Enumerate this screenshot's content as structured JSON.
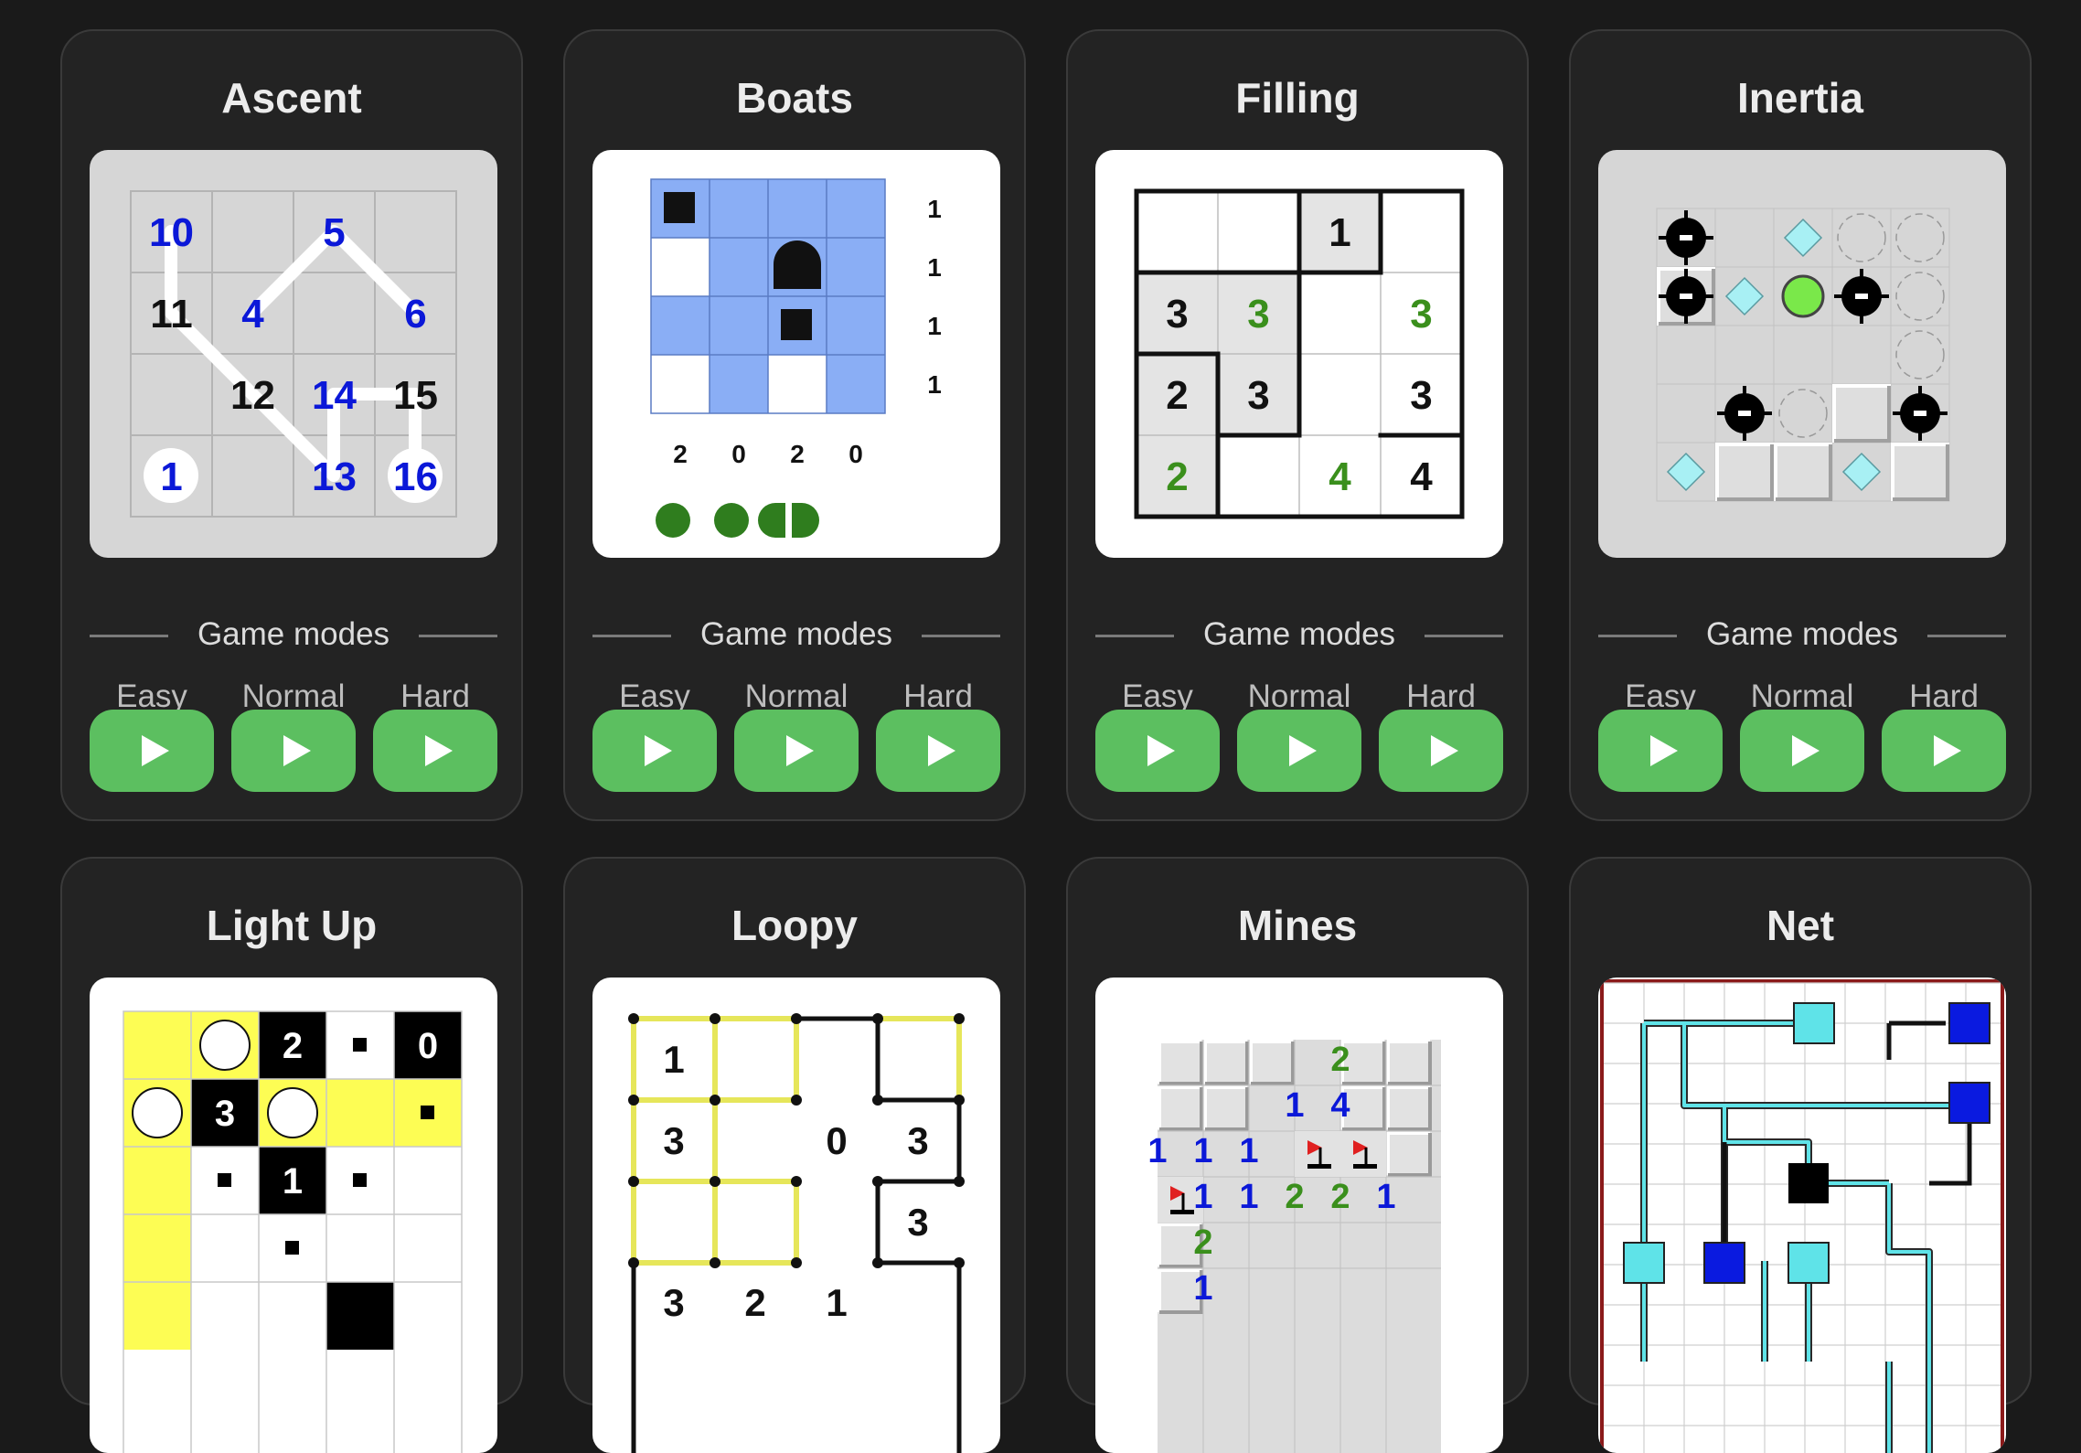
{
  "modes_label": "Game modes",
  "difficulties": [
    "Easy",
    "Normal",
    "Hard"
  ],
  "cards": [
    {
      "title": "Ascent"
    },
    {
      "title": "Boats"
    },
    {
      "title": "Filling"
    },
    {
      "title": "Inertia"
    },
    {
      "title": "Light Up"
    },
    {
      "title": "Loopy"
    },
    {
      "title": "Mines"
    },
    {
      "title": "Net"
    }
  ],
  "ascent": {
    "cells": [
      {
        "t": "10",
        "c": "blue"
      },
      {
        "t": "",
        "c": ""
      },
      {
        "t": "5",
        "c": "blue"
      },
      {
        "t": "",
        "c": ""
      },
      {
        "t": "11",
        "c": "black"
      },
      {
        "t": "4",
        "c": "blue"
      },
      {
        "t": "",
        "c": ""
      },
      {
        "t": "6",
        "c": "blue"
      },
      {
        "t": "",
        "c": ""
      },
      {
        "t": "12",
        "c": "black"
      },
      {
        "t": "14",
        "c": "blue"
      },
      {
        "t": "15",
        "c": "black"
      },
      {
        "t": "1",
        "c": "blue"
      },
      {
        "t": "",
        "c": ""
      },
      {
        "t": "13",
        "c": "blue"
      },
      {
        "t": "16",
        "c": "blue"
      }
    ]
  },
  "boats": {
    "row_clues": [
      "1",
      "1",
      "1",
      "1"
    ],
    "col_clues": [
      "2",
      "0",
      "2",
      "0"
    ]
  },
  "filling": {
    "cells": [
      {
        "t": "",
        "c": "black"
      },
      {
        "t": "",
        "c": "black"
      },
      {
        "t": "1",
        "c": "black"
      },
      {
        "t": "",
        "c": "black"
      },
      {
        "t": "3",
        "c": "black"
      },
      {
        "t": "3",
        "c": "green"
      },
      {
        "t": "",
        "c": "black"
      },
      {
        "t": "3",
        "c": "green"
      },
      {
        "t": "2",
        "c": "black"
      },
      {
        "t": "3",
        "c": "black"
      },
      {
        "t": "",
        "c": "black"
      },
      {
        "t": "3",
        "c": "black"
      },
      {
        "t": "2",
        "c": "green"
      },
      {
        "t": "",
        "c": "black"
      },
      {
        "t": "4",
        "c": "green"
      },
      {
        "t": "4",
        "c": "black"
      }
    ]
  },
  "lightup": {
    "clues": [
      "2",
      "0",
      "3",
      "1"
    ]
  },
  "loopy": {
    "clues": [
      "1",
      "3",
      "0",
      "3",
      "3",
      "3",
      "2",
      "1"
    ]
  },
  "mines": {
    "numbers": [
      "2",
      "1",
      "4",
      "1",
      "1",
      "1",
      "1",
      "1",
      "2",
      "2",
      "1",
      "2",
      "1"
    ]
  },
  "colors": {
    "background": "#1a1a1a",
    "card": "#232323",
    "play_button": "#5cbf60",
    "clue_blue": "#0b18d8",
    "clue_green": "#3a8f1c",
    "lightup_yellow": "#fdfd54",
    "loopy_yellow": "#e6e65a",
    "boats_water": "#8aaef5",
    "net_pipe": "#5fe3e8",
    "net_border": "#8b1a1a"
  }
}
